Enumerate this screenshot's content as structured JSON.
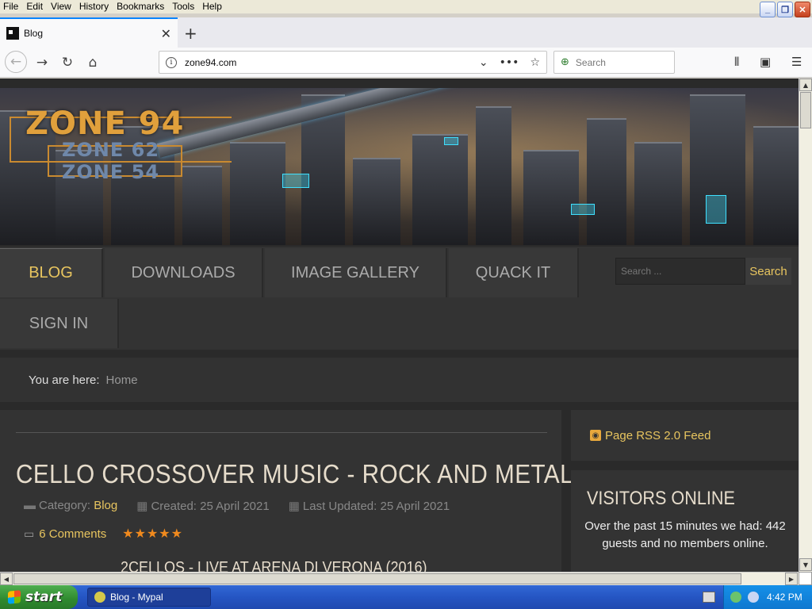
{
  "menubar": {
    "items": [
      "File",
      "Edit",
      "View",
      "History",
      "Bookmarks",
      "Tools",
      "Help"
    ]
  },
  "tab": {
    "title": "Blog"
  },
  "navbar": {
    "url": "zone94.com",
    "search_placeholder": "Search"
  },
  "banner": {
    "logo_main": "ZONE 94",
    "logo_sub1": "ZONE 62",
    "logo_sub2": "ZONE 54"
  },
  "site_nav": {
    "items": [
      "BLOG",
      "DOWNLOADS",
      "IMAGE GALLERY",
      "QUACK IT",
      "SIGN IN"
    ],
    "active": "BLOG",
    "search_placeholder": "Search ...",
    "search_button": "Search"
  },
  "breadcrumb": {
    "label": "You are here:",
    "home": "Home"
  },
  "article": {
    "title": "CELLO CROSSOVER MUSIC - ROCK AND METAL",
    "category_label": "Category:",
    "category": "Blog",
    "created": "Created: 25 April 2021",
    "updated": "Last Updated: 25 April 2021",
    "comments": "6 Comments",
    "rating_stars": 5,
    "subtitle": "2CELLOS - LIVE AT ARENA DI VERONA (2016)"
  },
  "sidebar": {
    "rss": "Page RSS 2.0 Feed",
    "visitors_title": "VISITORS ONLINE",
    "visitors_text": "Over the past 15 minutes we had: 442 guests and no members online."
  },
  "taskbar": {
    "start": "start",
    "task": "Blog - Mypal",
    "clock": "4:42 PM"
  },
  "colors": {
    "accent": "#e8c55f",
    "nav_bg": "#333333",
    "stars": "#f08a1e"
  }
}
